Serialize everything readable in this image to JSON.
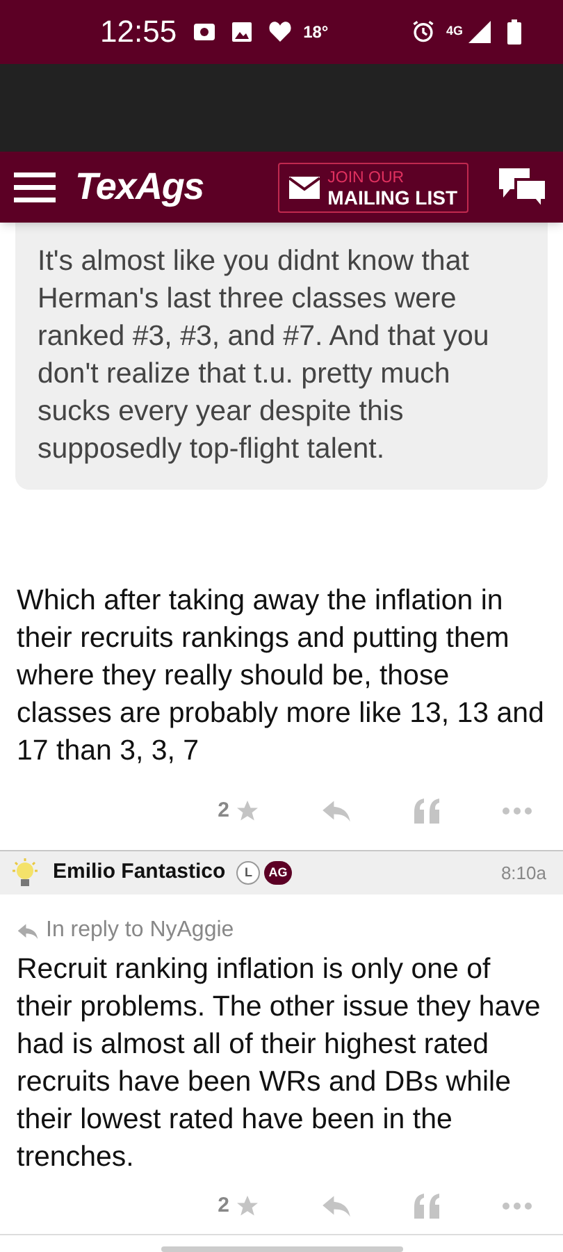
{
  "status_bar": {
    "time": "12:55",
    "temperature": "18°",
    "network": "4G"
  },
  "header": {
    "logo": "TexAgs",
    "mailing_top": "JOIN OUR",
    "mailing_bottom": "MAILING LIST"
  },
  "posts": [
    {
      "quote": {
        "text": "It's almost like you didnt know that Herman's last three classes were ranked #3, #3, and #7. And that you don't realize that t.u. pretty much sucks every year despite this supposedly top-flight talent."
      },
      "body": "Which after taking away the inflation in their recruits rankings and putting them where they really should be, those classes are probably more like 13, 13 and 17 than 3, 3, 7",
      "likes": "2"
    },
    {
      "author": {
        "name": "Emilio Fantastico",
        "badges": [
          {
            "text": "L",
            "kind": "outline"
          },
          {
            "text": "AG",
            "kind": "filled"
          }
        ],
        "time": "8:10a"
      },
      "reply_to": "In reply to NyAggie",
      "body": "Recruit ranking inflation is only one of their problems. The other issue they have had is almost all of their highest rated recruits have been WRs and DBs while their lowest rated have been in the trenches.",
      "likes": "2"
    }
  ]
}
